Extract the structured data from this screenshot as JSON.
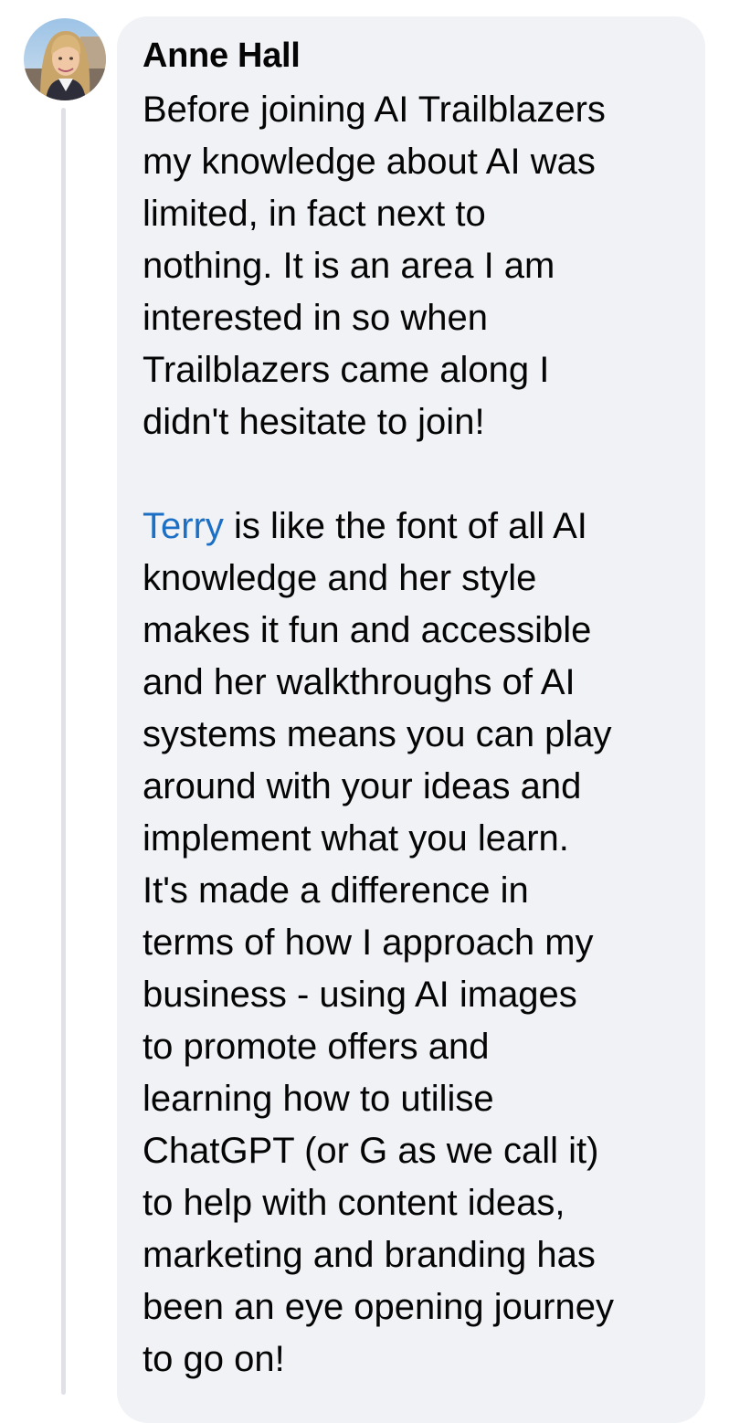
{
  "comment": {
    "author": "Anne Hall",
    "paragraph1": {
      "lines": [
        "Before joining AI Trailblazers",
        "my knowledge about AI was",
        "limited, in fact next to",
        "nothing. It is an area I am",
        "interested in so when",
        "Trailblazers came along I",
        "didn't hesitate to join!"
      ]
    },
    "paragraph2": {
      "mention": "Terry",
      "first_line_rest": " is like the font of all AI",
      "lines": [
        "knowledge and her style",
        "makes it fun and accessible",
        "and her walkthroughs of AI",
        "systems means you can play",
        "around with your ideas and",
        "implement what you learn.",
        "It's made a difference in",
        "terms of how I approach my",
        "business - using AI images",
        "to promote offers and",
        "learning how to utilise",
        "ChatGPT (or G as we call it)",
        "to help with content ideas,",
        "marketing and branding has",
        "been an eye opening journey",
        "to go on!"
      ]
    }
  },
  "colors": {
    "bubble_bg": "#f0f2f5",
    "text": "#050505",
    "mention": "#1b6fc5",
    "thread_line": "#dfe1e6"
  },
  "icons": {
    "avatar": "user-avatar-photo"
  }
}
